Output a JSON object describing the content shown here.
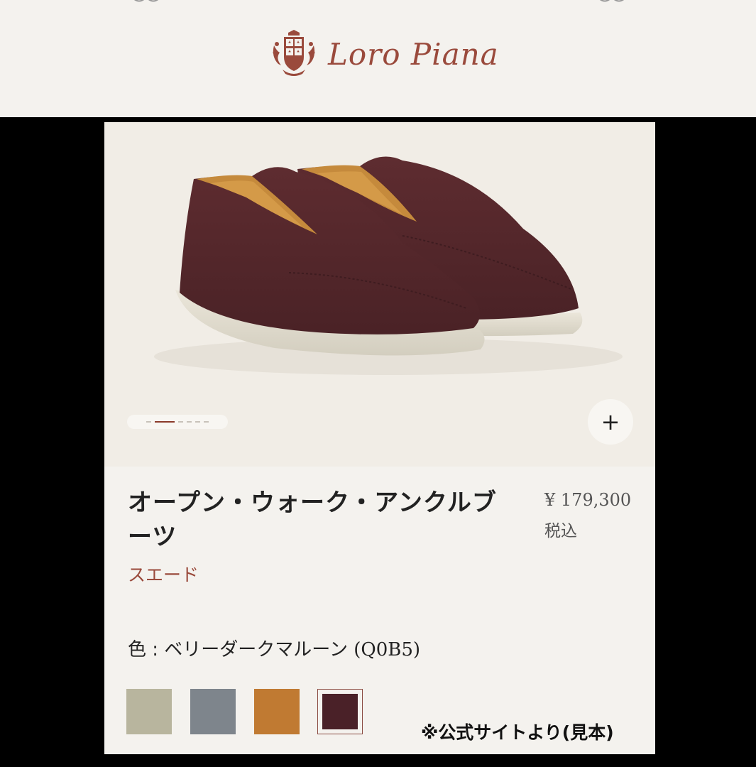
{
  "brand": {
    "name": "Loro Piana"
  },
  "gallery": {
    "image_alt": "Brown suede ankle boots with white soles",
    "pager_count": 6,
    "pager_active_index": 1,
    "zoom_label": "+"
  },
  "product": {
    "name": "オープン・ウォーク・アンクルブーツ",
    "material": "スエード",
    "price": "¥ 179,300",
    "tax_note": "税込",
    "color_label": "色 : ベリーダークマルーン",
    "color_code": "(Q0B5)"
  },
  "swatches": [
    {
      "name": "sage",
      "color": "#b8b59e",
      "selected": false
    },
    {
      "name": "slate",
      "color": "#7e858c",
      "selected": false
    },
    {
      "name": "caramel",
      "color": "#c07a32",
      "selected": false
    },
    {
      "name": "very-dark-maroon",
      "color": "#4a2128",
      "selected": true
    }
  ],
  "overlay_note": "※公式サイトより(見本)",
  "colors": {
    "accent": "#9a4a3c",
    "header_bg": "#f4f2ee",
    "card_bg": "#f4f2ee",
    "hero_bg": "#f1ede6"
  }
}
